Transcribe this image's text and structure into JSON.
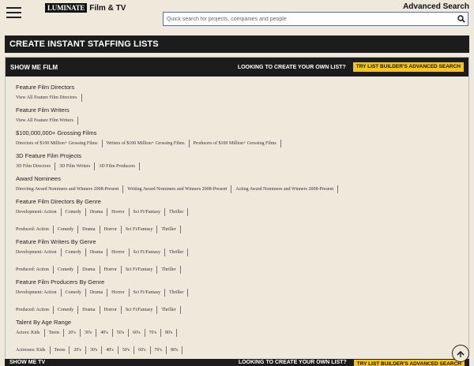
{
  "header": {
    "logo_box": "LUMINATE",
    "logo_text": "Film & TV",
    "advanced_search": "Advanced Search",
    "search_placeholder": "Quick search for projects, companies and people",
    "search_value": ""
  },
  "page": {
    "title": "CREATE INSTANT STAFFING LISTS"
  },
  "panel": {
    "label": "SHOW ME FILM",
    "question": "LOOKING TO CREATE YOUR OWN LIST?",
    "button": "TRY LIST BUILDER'S ADVANCED SEARCH",
    "categories": [
      {
        "title": "Feature Film Directors",
        "rows": [
          [
            "View All Feature Film Directors"
          ]
        ]
      },
      {
        "title": "Feature Film Writers",
        "rows": [
          [
            "View All Feature Film Writers"
          ]
        ]
      },
      {
        "title": "$100,000,000+ Grossing Films",
        "rows": [
          [
            "Directors of $100 Million+ Grossing Films",
            "Writers of $100 Million+ Grossing Films",
            "Producers of $100 Million+ Grossing Films"
          ]
        ]
      },
      {
        "title": "3D Feature Film Projects",
        "rows": [
          [
            "3D Film Directors",
            "3D Film Writers",
            "3D Film Producers"
          ]
        ]
      },
      {
        "title": "Award Nominees",
        "rows": [
          [
            "Directing Award Nominees and Winners 2008-Present",
            "Writing Award Nominees and Winners 2008-Present",
            "Acting Award Nominees and Winners 2008-Present"
          ]
        ]
      },
      {
        "title": "Feature Film Directors By Genre",
        "rows": [
          [
            "Development: Action",
            "Comedy",
            "Drama",
            "Horror",
            "Sci Fi/Fantasy",
            "Thriller"
          ],
          [
            "Produced: Action",
            "Comedy",
            "Drama",
            "Horror",
            "Sci Fi/Fantasy",
            "Thriller"
          ]
        ]
      },
      {
        "title": "Feature Film Writers By Genre",
        "rows": [
          [
            "Development: Action",
            "Comedy",
            "Drama",
            "Horror",
            "Sci Fi/Fantasy",
            "Thriller"
          ],
          [
            "Produced: Action",
            "Comedy",
            "Drama",
            "Horror",
            "Sci Fi/Fantasy",
            "Thriller"
          ]
        ]
      },
      {
        "title": "Feature Film Producers By Genre",
        "rows": [
          [
            "Development: Action",
            "Comedy",
            "Drama",
            "Horror",
            "Sci Fi/Fantasy",
            "Thriller"
          ],
          [
            "Produced: Action",
            "Comedy",
            "Drama",
            "Horror",
            "Sci Fi/Fantasy",
            "Thriller"
          ]
        ]
      },
      {
        "title": "Talent By Age Range",
        "rows": [
          [
            "Actors: Kids",
            "Teens",
            "20's",
            "30's",
            "40's",
            "50's",
            "60's",
            "70's",
            "80's"
          ],
          [
            "Actresses: Kids",
            "Teens",
            "20's",
            "30's",
            "40's",
            "50's",
            "60's",
            "70's",
            "80's"
          ]
        ]
      }
    ]
  },
  "bottom_panel": {
    "label": "SHOW ME TV",
    "question": "LOOKING TO CREATE YOUR OWN LIST?",
    "button": "TRY LIST BUILDER'S ADVANCED SEARCH"
  },
  "icons": {
    "menu": "hamburger-menu-icon",
    "search": "search-icon",
    "scroll_top": "chevron-up-icon"
  },
  "colors": {
    "background": "#efe9dc",
    "bar": "#1c1c1c",
    "accent": "#f5c518",
    "search_border": "#4b74b8"
  }
}
